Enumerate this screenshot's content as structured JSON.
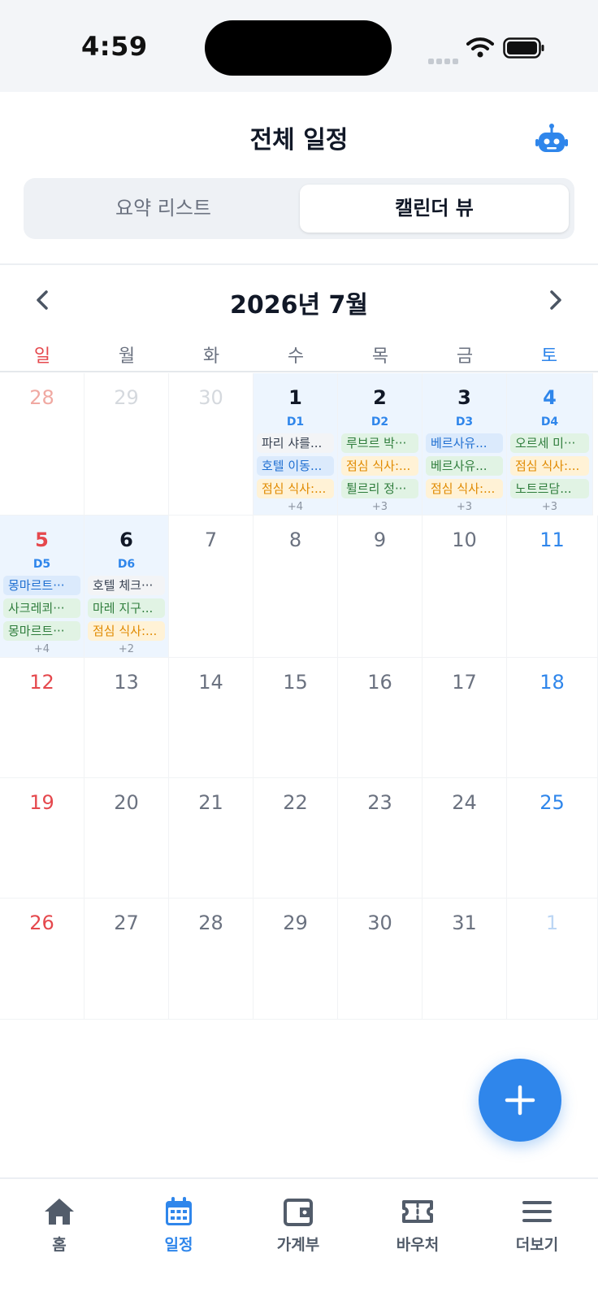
{
  "status_bar": {
    "time": "4:59"
  },
  "header": {
    "title": "전체 일정",
    "assistant_icon": "robot-icon"
  },
  "view_toggle": {
    "tabs": [
      {
        "label": "요약 리스트",
        "active": false
      },
      {
        "label": "캘린더 뷰",
        "active": true
      }
    ]
  },
  "calendar": {
    "month_label": "2026년 7월",
    "weekdays": [
      "일",
      "월",
      "화",
      "수",
      "목",
      "금",
      "토"
    ],
    "weeks": [
      [
        {
          "day": "28"
        },
        {
          "day": "29"
        },
        {
          "day": "30"
        },
        {
          "day": "1",
          "dlabel": "D1",
          "events": [
            "파리 샤를...",
            "호텔 이동...",
            "점심 식사:..."
          ],
          "more": "+4"
        },
        {
          "day": "2",
          "dlabel": "D2",
          "events": [
            "루브르 박···",
            "점심 식사:...",
            "튈르리 정···"
          ],
          "more": "+3"
        },
        {
          "day": "3",
          "dlabel": "D3",
          "events": [
            "베르사유...",
            "베르사유...",
            "점심 식사:..."
          ],
          "more": "+3"
        },
        {
          "day": "4",
          "dlabel": "D4",
          "events": [
            "오르세 미···",
            "점심 식사:...",
            "노트르담..."
          ],
          "more": "+3"
        }
      ],
      [
        {
          "day": "5",
          "dlabel": "D5",
          "events": [
            "몽마르트···",
            "사크레쾨···",
            "몽마르트···"
          ],
          "more": "+4"
        },
        {
          "day": "6",
          "dlabel": "D6",
          "events": [
            "호텔 체크···",
            "마레 지구...",
            "점심 식사:..."
          ],
          "more": "+2"
        },
        {
          "day": "7"
        },
        {
          "day": "8"
        },
        {
          "day": "9"
        },
        {
          "day": "10"
        },
        {
          "day": "11"
        }
      ],
      [
        {
          "day": "12"
        },
        {
          "day": "13"
        },
        {
          "day": "14"
        },
        {
          "day": "15"
        },
        {
          "day": "16"
        },
        {
          "day": "17"
        },
        {
          "day": "18"
        }
      ],
      [
        {
          "day": "19"
        },
        {
          "day": "20"
        },
        {
          "day": "21"
        },
        {
          "day": "22"
        },
        {
          "day": "23"
        },
        {
          "day": "24"
        },
        {
          "day": "25"
        }
      ],
      [
        {
          "day": "26"
        },
        {
          "day": "27"
        },
        {
          "day": "28"
        },
        {
          "day": "29"
        },
        {
          "day": "30"
        },
        {
          "day": "31"
        },
        {
          "day": "1"
        }
      ]
    ]
  },
  "fab": {
    "icon": "plus-icon"
  },
  "bottom_nav": [
    {
      "label": "홈",
      "icon": "home-icon",
      "active": false
    },
    {
      "label": "일정",
      "icon": "calendar-icon",
      "active": true
    },
    {
      "label": "가계부",
      "icon": "wallet-icon",
      "active": false
    },
    {
      "label": "바우처",
      "icon": "ticket-icon",
      "active": false
    },
    {
      "label": "더보기",
      "icon": "menu-icon",
      "active": false
    }
  ],
  "colors": {
    "accent": "#2f86eb",
    "sunday": "#e5484d",
    "saturday": "#2f86eb",
    "trip_day_bg": "#edf5fe"
  }
}
